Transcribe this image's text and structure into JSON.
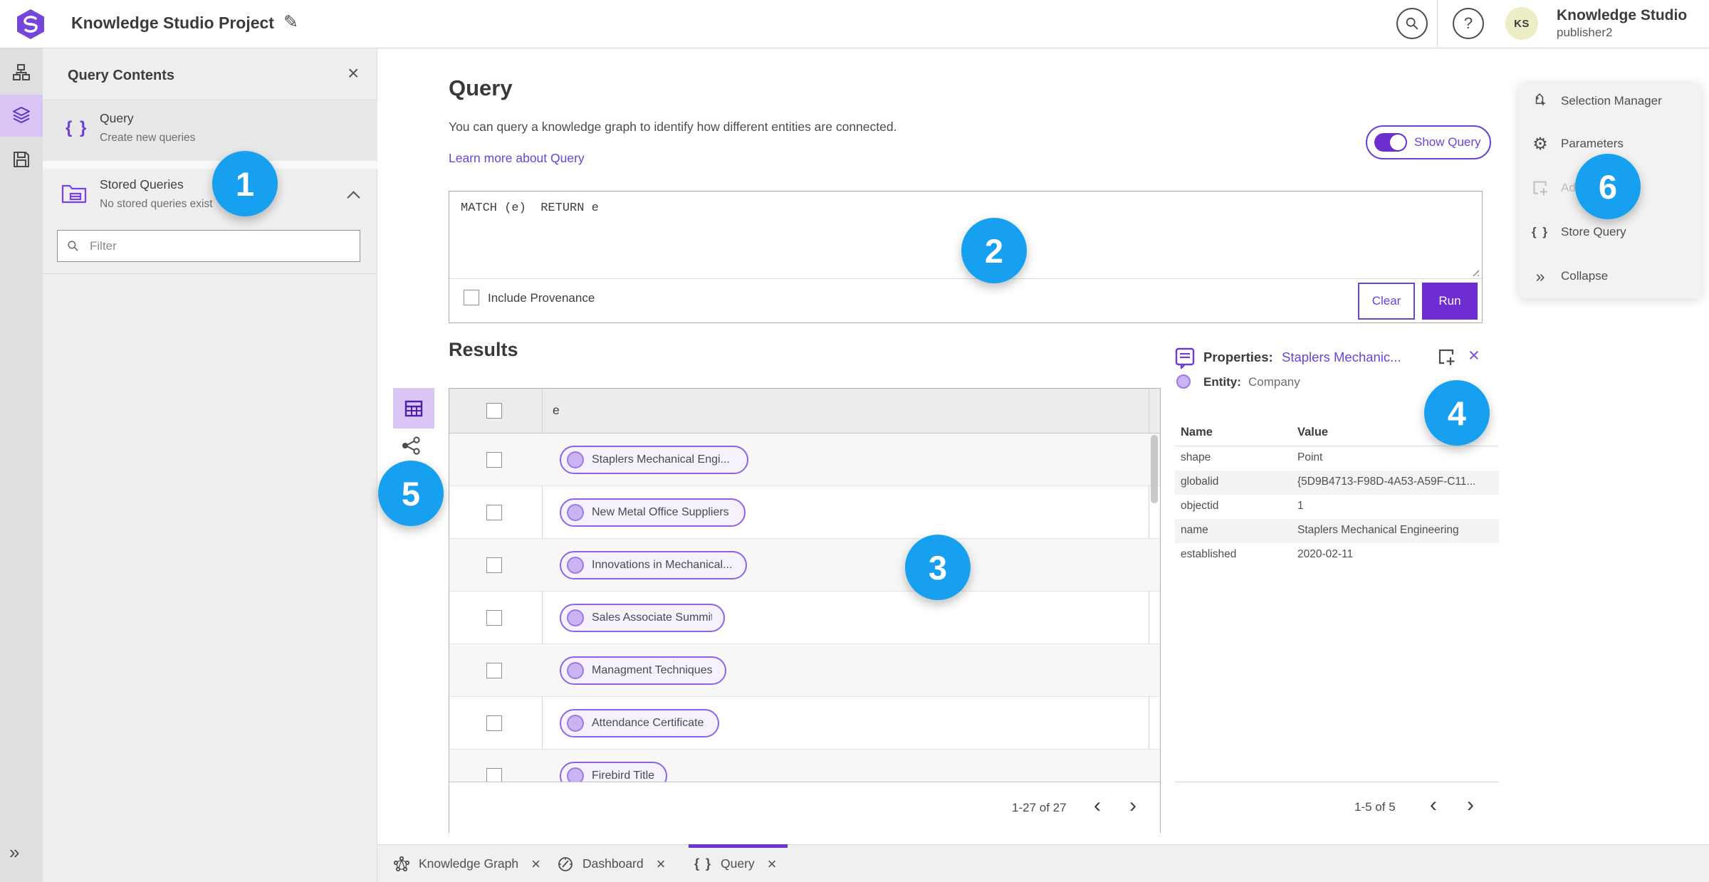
{
  "colors": {
    "accent_purple": "#6a43d8",
    "run_button": "#6f2cd2",
    "badge_blue": "#18a0f0",
    "entity_fill": "#cbb2f0",
    "entity_border": "#9d79e4",
    "rail_selected": "#d9c4f6"
  },
  "icons": {
    "help": "?",
    "close": "×",
    "braces": "{ }",
    "prev": "‹",
    "next": "›",
    "gear": "⚙",
    "double_chevron": "»",
    "edit": "✎"
  },
  "topbar": {
    "title": "Knowledge Studio Project",
    "user_name": "Knowledge Studio",
    "user_role": "publisher2",
    "avatar_initials": "KS"
  },
  "left_panel": {
    "title": "Query Contents",
    "query_item": {
      "title": "Query",
      "subtitle": "Create new queries"
    },
    "stored_item": {
      "title": "Stored Queries",
      "subtitle": "No stored queries exist"
    },
    "filter_placeholder": "Filter"
  },
  "query_section": {
    "title": "Query",
    "description": "You can query a knowledge graph to identify how different entities are connected.",
    "learn_more": "Learn more about Query",
    "show_query": "Show Query",
    "query_text": "MATCH (e)  RETURN e",
    "include_provenance": "Include Provenance",
    "clear": "Clear",
    "run": "Run"
  },
  "results": {
    "title": "Results",
    "column_e": "e",
    "rows": [
      "Staplers Mechanical Engi...",
      "New Metal Office Suppliers",
      "Innovations in Mechanical...",
      "Sales Associate Summit",
      "Managment Techniques",
      "Attendance Certificate",
      "Firebird Title"
    ],
    "pagination": "1-27 of 27"
  },
  "properties": {
    "label": "Properties:",
    "entity_link": "Staplers Mechanic...",
    "entity_label": "Entity:",
    "entity_type": "Company",
    "columns": {
      "name": "Name",
      "value": "Value"
    },
    "rows": [
      {
        "name": "shape",
        "value": "Point"
      },
      {
        "name": "globalid",
        "value": "{5D9B4713-F98D-4A53-A59F-C11..."
      },
      {
        "name": "objectid",
        "value": "1"
      },
      {
        "name": "name",
        "value": "Staplers Mechanical Engineering"
      },
      {
        "name": "established",
        "value": "2020-02-11"
      }
    ],
    "pagination": "1-5 of 5"
  },
  "side_menu": {
    "items": [
      {
        "label": "Selection Manager",
        "disabled": false
      },
      {
        "label": "Parameters",
        "disabled": false
      },
      {
        "label": "Ad",
        "disabled": true
      },
      {
        "label": "Store Query",
        "disabled": false
      },
      {
        "label": "Collapse",
        "disabled": false
      }
    ]
  },
  "tabs": [
    {
      "label": "Knowledge Graph",
      "active": false
    },
    {
      "label": "Dashboard",
      "active": false
    },
    {
      "label": "Query",
      "active": true
    }
  ],
  "badges": [
    "1",
    "2",
    "3",
    "4",
    "5",
    "6"
  ]
}
